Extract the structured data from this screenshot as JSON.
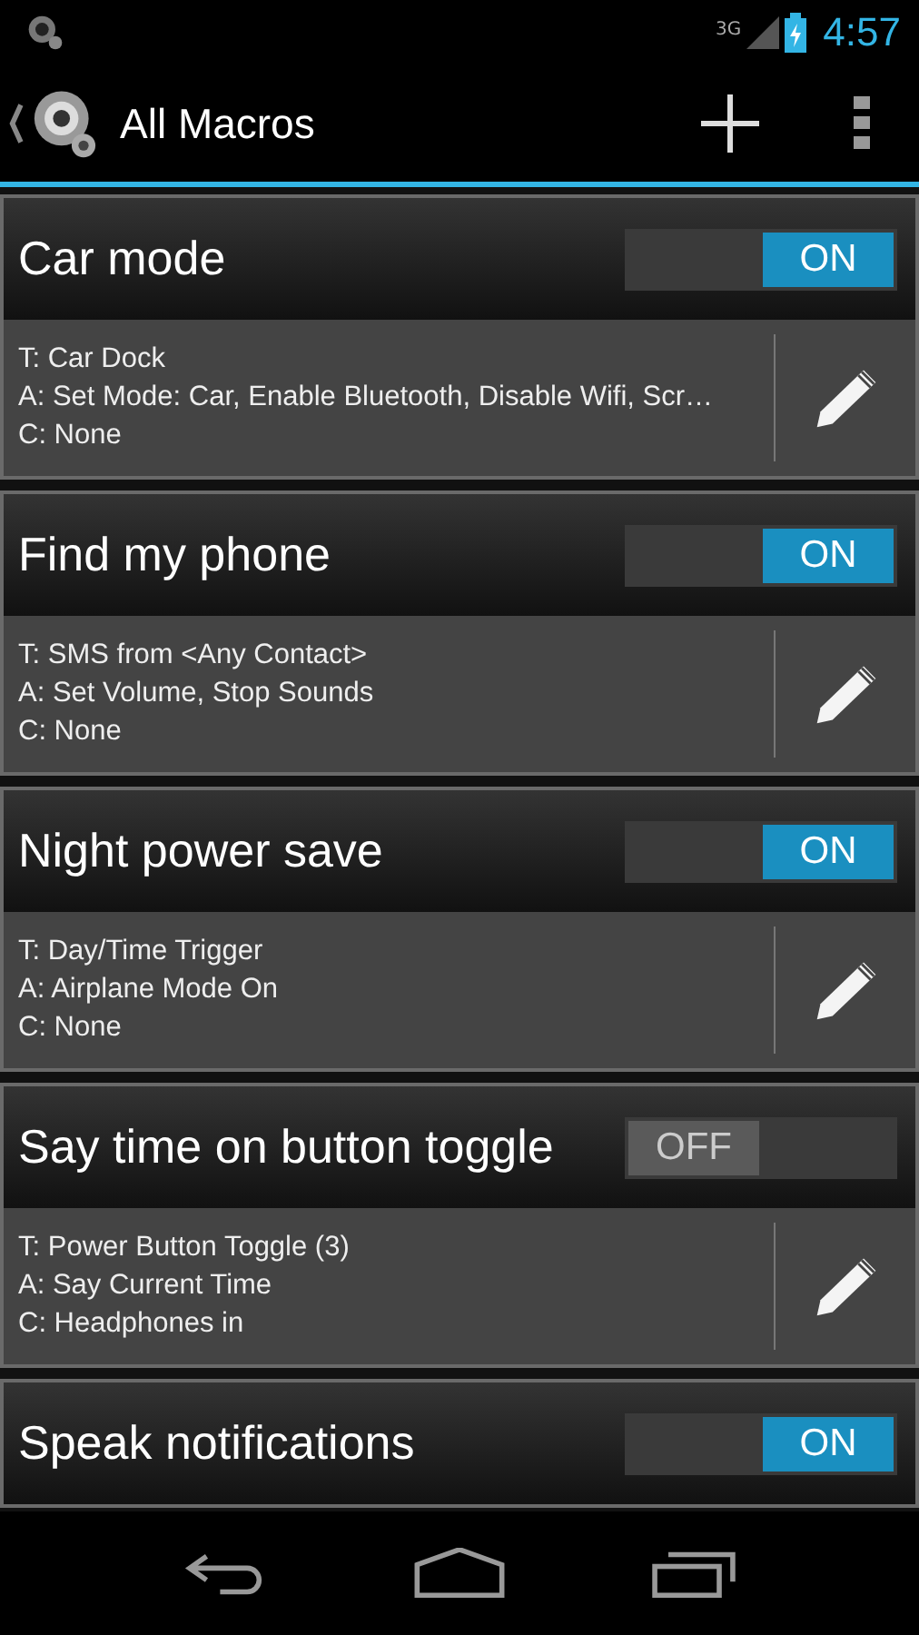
{
  "status_bar": {
    "network": "3G",
    "time": "4:57"
  },
  "action_bar": {
    "title": "All Macros"
  },
  "macros": [
    {
      "name": "Car mode",
      "enabled": true,
      "toggle_label": "ON",
      "trigger": "T: Car Dock",
      "actions": "A: Set Mode: Car, Enable Bluetooth, Disable Wifi, Scr…",
      "constraints": "C: None"
    },
    {
      "name": "Find my phone",
      "enabled": true,
      "toggle_label": "ON",
      "trigger": "T: SMS from <Any Contact>",
      "actions": "A: Set Volume, Stop Sounds",
      "constraints": "C: None"
    },
    {
      "name": "Night power save",
      "enabled": true,
      "toggle_label": "ON",
      "trigger": "T: Day/Time Trigger",
      "actions": "A: Airplane Mode On",
      "constraints": "C: None"
    },
    {
      "name": "Say time on button toggle",
      "enabled": false,
      "toggle_label": "OFF",
      "trigger": "T: Power Button Toggle (3)",
      "actions": "A: Say Current Time",
      "constraints": "C: Headphones in"
    },
    {
      "name": "Speak notifications",
      "enabled": true,
      "toggle_label": "ON"
    }
  ]
}
